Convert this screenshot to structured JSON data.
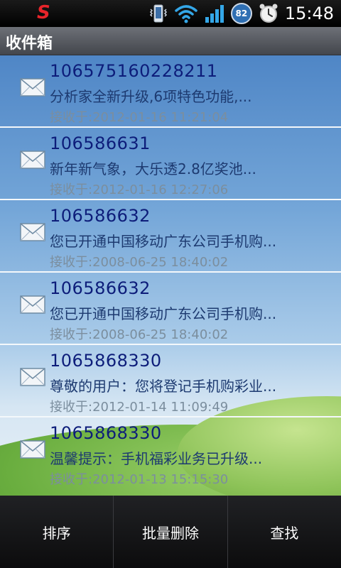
{
  "status_bar": {
    "logo": "S",
    "battery_level": "82",
    "time": "15:48"
  },
  "title_bar": {
    "title": "收件箱"
  },
  "messages": [
    {
      "sender": "106575160228211",
      "preview": "分析家全新升级,6项特色功能,...",
      "received": "接收于:2012-01-16 11:21:04"
    },
    {
      "sender": "106586631",
      "preview": "新年新气象，大乐透2.8亿奖池...",
      "received": "接收于:2012-01-16 12:27:06"
    },
    {
      "sender": "106586632",
      "preview": "您已开通中国移动广东公司手机购...",
      "received": "接收于:2008-06-25 18:40:02"
    },
    {
      "sender": "106586632",
      "preview": "您已开通中国移动广东公司手机购...",
      "received": "接收于:2008-06-25 18:40:02"
    },
    {
      "sender": "1065868330",
      "preview": "尊敬的用户：您将登记手机购彩业...",
      "received": "接收于:2012-01-14 11:09:49"
    },
    {
      "sender": "1065868330",
      "preview": " 温馨提示：手机福彩业务已升级...",
      "received": "接收于:2012-01-13 15:15:30"
    }
  ],
  "menu": {
    "sort": "排序",
    "batch_delete": "批量删除",
    "search": "查找"
  }
}
